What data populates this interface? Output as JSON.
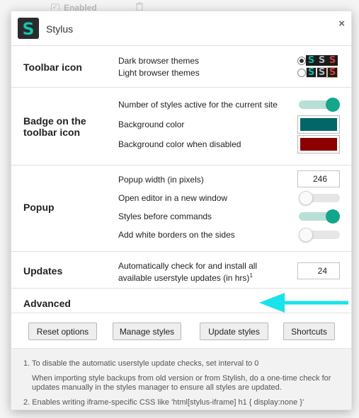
{
  "background": {
    "enabled_label": "Enabled"
  },
  "dialog": {
    "title": "Stylus",
    "close_glyph": "×"
  },
  "toolbar_icon": {
    "label": "Toolbar icon",
    "rows": [
      {
        "label": "Dark browser themes",
        "selected": true
      },
      {
        "label": "Light browser themes",
        "selected": false
      }
    ],
    "icon_letter": "S",
    "icon_colors": [
      "#17b3a3",
      "#b8b8b8",
      "#d33a3a"
    ]
  },
  "badge": {
    "label_line1": "Badge on the",
    "label_line2": "toolbar icon",
    "rows": [
      {
        "label": "Number of styles active for the current site",
        "type": "toggle",
        "on": true
      },
      {
        "label": "Background color",
        "type": "color",
        "color": "#006666"
      },
      {
        "label": "Background color when disabled",
        "type": "color",
        "color": "#8b0000"
      }
    ]
  },
  "popup": {
    "label": "Popup",
    "rows": [
      {
        "label": "Popup width (in pixels)",
        "type": "number",
        "value": "246"
      },
      {
        "label": "Open editor in a new window",
        "type": "toggle",
        "on": false
      },
      {
        "label": "Styles before commands",
        "type": "toggle",
        "on": true
      },
      {
        "label": "Add white borders on the sides",
        "type": "toggle",
        "on": false
      }
    ]
  },
  "updates": {
    "label": "Updates",
    "row_line1": "Automatically check for and install all",
    "row_line2": "available userstyle updates (in hrs)",
    "footnote_ref": "1",
    "value": "24"
  },
  "advanced": {
    "label": "Advanced"
  },
  "buttons": {
    "reset": "Reset options",
    "manage": "Manage styles",
    "update": "Update styles",
    "shortcuts": "Shortcuts"
  },
  "notes": {
    "note1": "1. To disable the automatic userstyle update checks, set interval to 0",
    "note1_sub": "When importing style backups from old version or from Stylish, do a one-time check for updates manually in the styles manager to ensure all styles are updated.",
    "note2": "2. Enables writing iframe-specific CSS like 'html[stylus-iframe] h1 { display:none }'"
  },
  "colors": {
    "accent": "#14a68a",
    "arrow": "#19e3ea"
  }
}
